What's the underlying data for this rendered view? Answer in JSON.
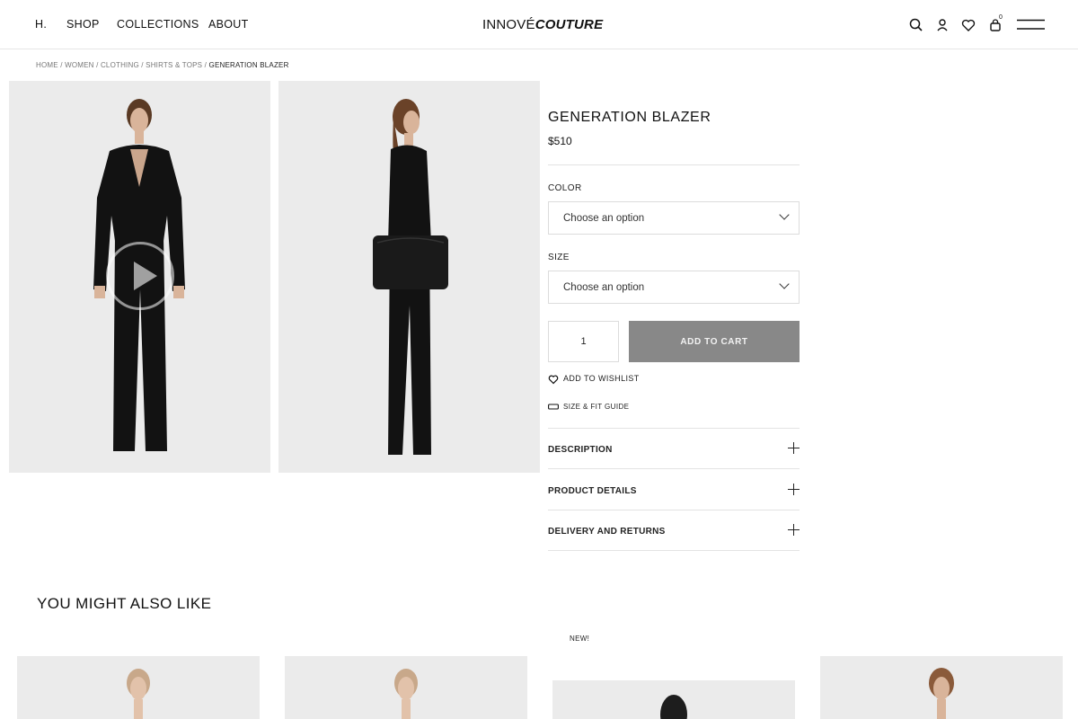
{
  "header": {
    "nav": [
      "H.",
      "SHOP",
      "COLLECTIONS",
      "ABOUT"
    ],
    "logo_first": "INNOVÉ",
    "logo_second": "COUTURE",
    "cart_count": "0",
    "icons": [
      "search-icon",
      "user-icon",
      "heart-icon",
      "bag-icon",
      "menu-icon"
    ]
  },
  "breadcrumb": {
    "items": [
      "HOME",
      "WOMEN",
      "CLOTHING",
      "SHIRTS & TOPS"
    ],
    "current": "GENERATION BLAZER"
  },
  "product": {
    "title": "GENERATION BLAZER",
    "price": "$510",
    "color_label": "COLOR",
    "color_value": "Choose an option",
    "size_label": "SIZE",
    "size_value": "Choose an option",
    "quantity": "1",
    "add_to_cart": "ADD TO CART",
    "wishlist": "ADD TO WISHLIST",
    "size_guide": "SIZE & FIT GUIDE",
    "accordion": [
      "DESCRIPTION",
      "PRODUCT DETAILS",
      "DELIVERY AND RETURNS"
    ]
  },
  "recommendations": {
    "title": "YOU MIGHT ALSO LIKE",
    "badge": "NEW!"
  },
  "colors": {
    "button_bg": "#888888",
    "image_bg": "#ebebeb",
    "outfit": "#111111"
  }
}
